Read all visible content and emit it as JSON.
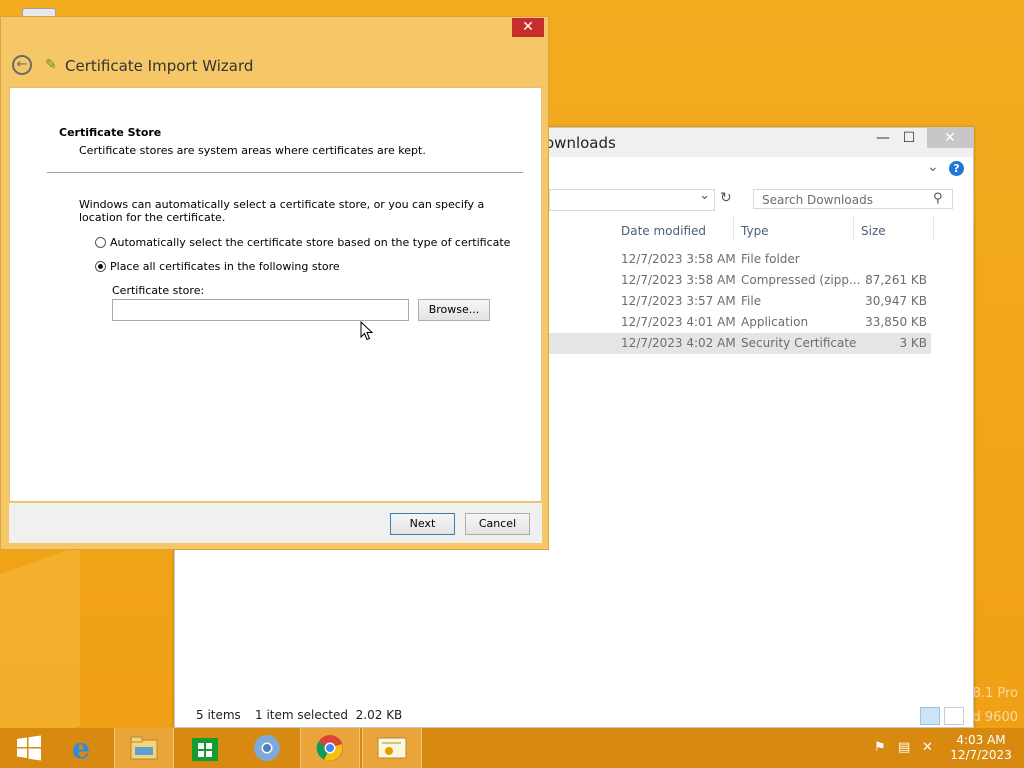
{
  "desktop": {
    "watermark_line1": "8.1 Pro",
    "watermark_line2": "d 9600"
  },
  "explorer": {
    "title": "Downloads",
    "title_visible": "ownloads",
    "search_placeholder": "Search Downloads",
    "columns": [
      "Date modified",
      "Type",
      "Size"
    ],
    "rows": [
      {
        "date": "12/7/2023 3:58 AM",
        "type": "File folder",
        "size": ""
      },
      {
        "date": "12/7/2023 3:58 AM",
        "type": "Compressed (zipp...",
        "size": "87,261 KB"
      },
      {
        "date": "12/7/2023 3:57 AM",
        "type": "File",
        "size": "30,947 KB"
      },
      {
        "date": "12/7/2023 4:01 AM",
        "type": "Application",
        "size": "33,850 KB"
      },
      {
        "date": "12/7/2023 4:02 AM",
        "type": "Security Certificate",
        "size": "3 KB"
      }
    ],
    "status_items": "5 items",
    "status_selected": "1 item selected  2.02 KB",
    "minimize_glyph": "—",
    "maximize_glyph": "☐",
    "close_glyph": "✕",
    "help_glyph": "?",
    "refresh_glyph": "↻",
    "search_glyph": "⚲",
    "dropdown_glyph": "⌄",
    "expand_ribbon_glyph": "⌄"
  },
  "wizard": {
    "title": "Certificate Import Wizard",
    "close_glyph": "✕",
    "back_glyph": "←",
    "cert_glyph": "✎",
    "heading": "Certificate Store",
    "description": "Certificate stores are system areas where certificates are kept.",
    "intro": "Windows can automatically select a certificate store, or you can specify a location for the certificate.",
    "radio_auto": "Automatically select the certificate store based on the type of certificate",
    "radio_manual": "Place all certificates in the following store",
    "store_label": "Certificate store:",
    "store_value": "",
    "browse_label": "Browse...",
    "next_label": "Next",
    "cancel_label": "Cancel",
    "selected_option": "manual"
  },
  "taskbar": {
    "time": "4:03 AM",
    "date": "12/7/2023",
    "items": [
      "start",
      "internet-explorer",
      "file-explorer",
      "store",
      "chromium",
      "chrome",
      "certificate-wizard"
    ]
  },
  "colors": {
    "desktop": "#f2a51d",
    "taskbar": "#d88a10",
    "wizard_frame": "#f5c767",
    "close_red": "#c7302a"
  }
}
